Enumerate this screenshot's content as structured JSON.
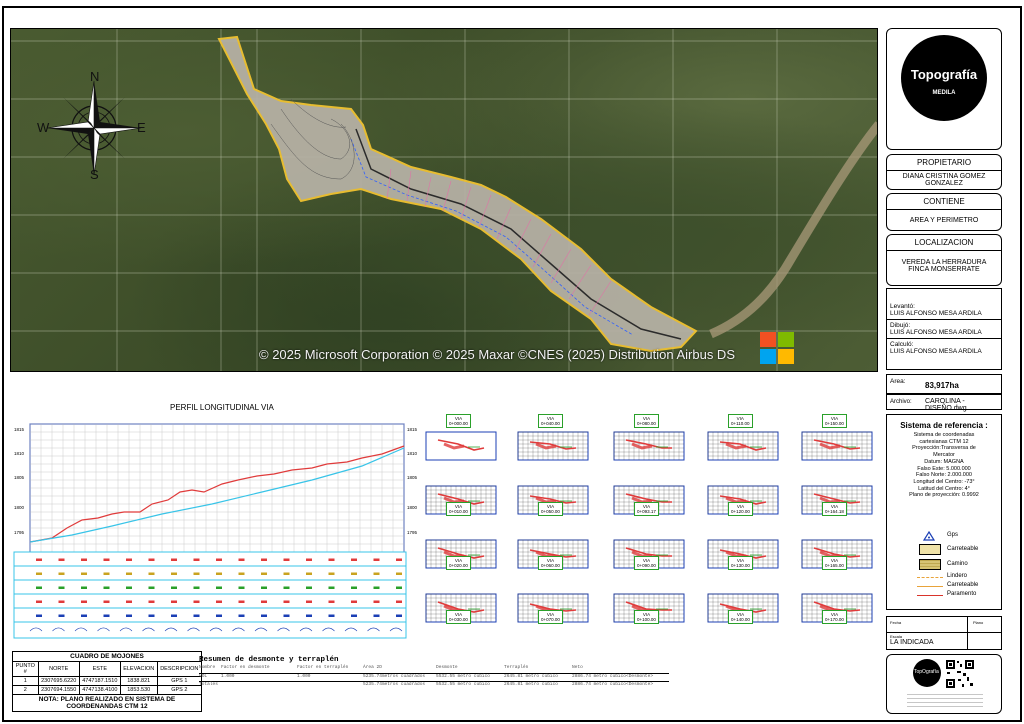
{
  "map": {
    "copyright": "© 2025 Microsoft Corporation © 2025 Maxar ©CNES (2025) Distribution Airbus DS",
    "compass": {
      "n": "N",
      "s": "S",
      "e": "E",
      "w": "W"
    }
  },
  "title_block": {
    "logo_text_1": "Topografía",
    "logo_text_2": "MEDILA",
    "propietario_label": "PROPIETARIO",
    "propietario_value": "DIANA CRISTINA GOMEZ GONZALEZ",
    "contiene_label": "CONTIENE",
    "contiene_value": "AREA Y PERIMETRO",
    "localizacion_label": "LOCALIZACION",
    "localizacion_value_1": "VEREDA LA HERRADURA",
    "localizacion_value_2": "FINCA MONSERRATE",
    "levanto_label": "Levantó:",
    "levanto_value": "LUIS ALFONSO MESA ARDILA",
    "dibujo_label": "Dibujó:",
    "dibujo_value": "LUIS ALFONSO MESA ARDILA",
    "calculo_label": "Calculó:",
    "calculo_value": "LUIS ALFONSO MESA ARDILA",
    "area_label": "Area:",
    "area_value": "83,917ha",
    "archivo_label": "Archivo:",
    "archivo_value": "CAROLINA - DISEÑO.dwg",
    "referencia_title": "Sistema de referencia :",
    "referencia_lines": [
      "Sistema de coordenadas",
      "cartesianas CTM 12",
      "Proyección:Transversa de",
      "Mercator",
      "Datum: MAGNA",
      "Falso Este: 5.000.000",
      "Falso Norte: 2.000.000",
      "Longitud del Centro: -73°",
      "Latitud del Centro: 4°",
      "Plano de proyección: 0.9992"
    ],
    "legend": [
      {
        "label": "Gps",
        "icon": "gps-triangle-icon"
      },
      {
        "label": "Carreteable",
        "icon": "carreteable-swatch"
      },
      {
        "label": "Camino",
        "icon": "camino-swatch"
      },
      {
        "label": "Lindero",
        "icon": "lindero-line"
      },
      {
        "label": "Carreteable",
        "icon": "carreteable-line"
      },
      {
        "label": "Paramento",
        "icon": "paramento-line"
      }
    ],
    "fecha_label": "Fecha",
    "plano_label": "Plano",
    "escala_label": "Escala",
    "escala_value": "LA INDICADA",
    "footer_logo_text": "TopOgrafía"
  },
  "profile": {
    "title": "PERFIL LONGITUDINAL  VIA",
    "left_ticks": [
      "1815",
      "1810",
      "1805",
      "1800",
      "1795"
    ],
    "right_ticks": [
      "1815",
      "1810",
      "1805",
      "1800",
      "1795"
    ]
  },
  "cross_sections": {
    "label_title": "VIA",
    "stations": [
      "0+000.00",
      "0+040.00",
      "0+080.00",
      "0+110.00",
      "0+150.00",
      "0+010.00",
      "0+050.00",
      "0+093.17",
      "0+120.00",
      "0+164.18",
      "0+020.00",
      "0+060.00",
      "0+090.00",
      "0+130.00",
      "0+165.00",
      "0+030.00",
      "0+070.00",
      "0+100.00",
      "0+140.00",
      "0+170.00"
    ]
  },
  "mojones": {
    "caption": "CUADRO DE MOJONES",
    "headers": [
      "PUNTO #",
      "NORTE",
      "ESTE",
      "ELEVACION",
      "DESCRIPCION"
    ],
    "rows": [
      [
        "1",
        "2307695.6220",
        "4747187.1510",
        "1838.821",
        "GPS 1"
      ],
      [
        "2",
        "2307694.1550",
        "4747138.4100",
        "1853.530",
        "GPS 2"
      ]
    ],
    "note": "NOTA: PLANO REALIZADO  EN SISTEMA DE COORDENANDAS  CTM 12"
  },
  "resumen": {
    "title": "Resumen de desmonte y terraplén",
    "headers": [
      "Nombre",
      "Factor en desmonte",
      "Factor en terraplén",
      "Área 2D",
      "Desmonte",
      "Terraplén",
      "Neto"
    ],
    "row1": [
      "VOL",
      "1.000",
      "1.000",
      "5235.74metros cuadrados",
      "5532.55 metro cúbico",
      "2645.81 metro cúbico",
      "2886.74 metro cúbico<Desmonte>"
    ],
    "row2": [
      "Totales",
      "",
      "",
      "5235.74metros cuadrados",
      "5532.55 metro cúbico",
      "2645.81 metro cúbico",
      "2886.74 metro cúbico<Desmonte>"
    ]
  }
}
